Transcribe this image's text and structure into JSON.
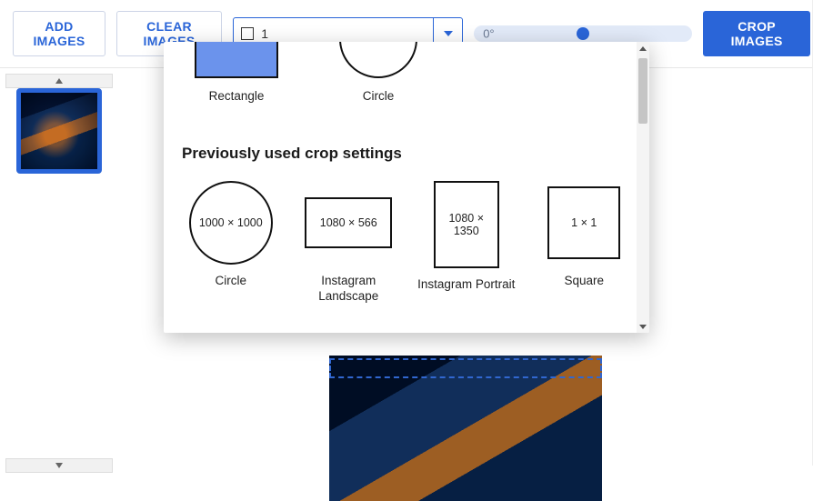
{
  "toolbar": {
    "add_images_label": "ADD IMAGES",
    "clear_images_label": "CLEAR IMAGES",
    "crop_images_label": "CROP IMAGES",
    "ratio": {
      "value": "1",
      "dropdown_icon": "chevron-down"
    },
    "rotation": {
      "value_label": "0°",
      "thumb_position_pct": 50
    }
  },
  "dropdown": {
    "shapes": [
      {
        "label": "Rectangle",
        "type": "rect"
      },
      {
        "label": "Circle",
        "type": "circle"
      }
    ],
    "section_title": "Previously used crop settings",
    "presets": [
      {
        "label": "Circle",
        "shape": "circle",
        "dim_text": "1000 × 1000"
      },
      {
        "label": "Instagram Landscape",
        "shape": "landscape",
        "dim_text": "1080 × 566"
      },
      {
        "label": "Instagram Portrait",
        "shape": "portrait",
        "dim_text": "1080 × 1350"
      },
      {
        "label": "Square",
        "shape": "square",
        "dim_text": "1 × 1"
      }
    ]
  },
  "sidebar": {
    "thumbnails": [
      {
        "selected": true
      }
    ]
  }
}
